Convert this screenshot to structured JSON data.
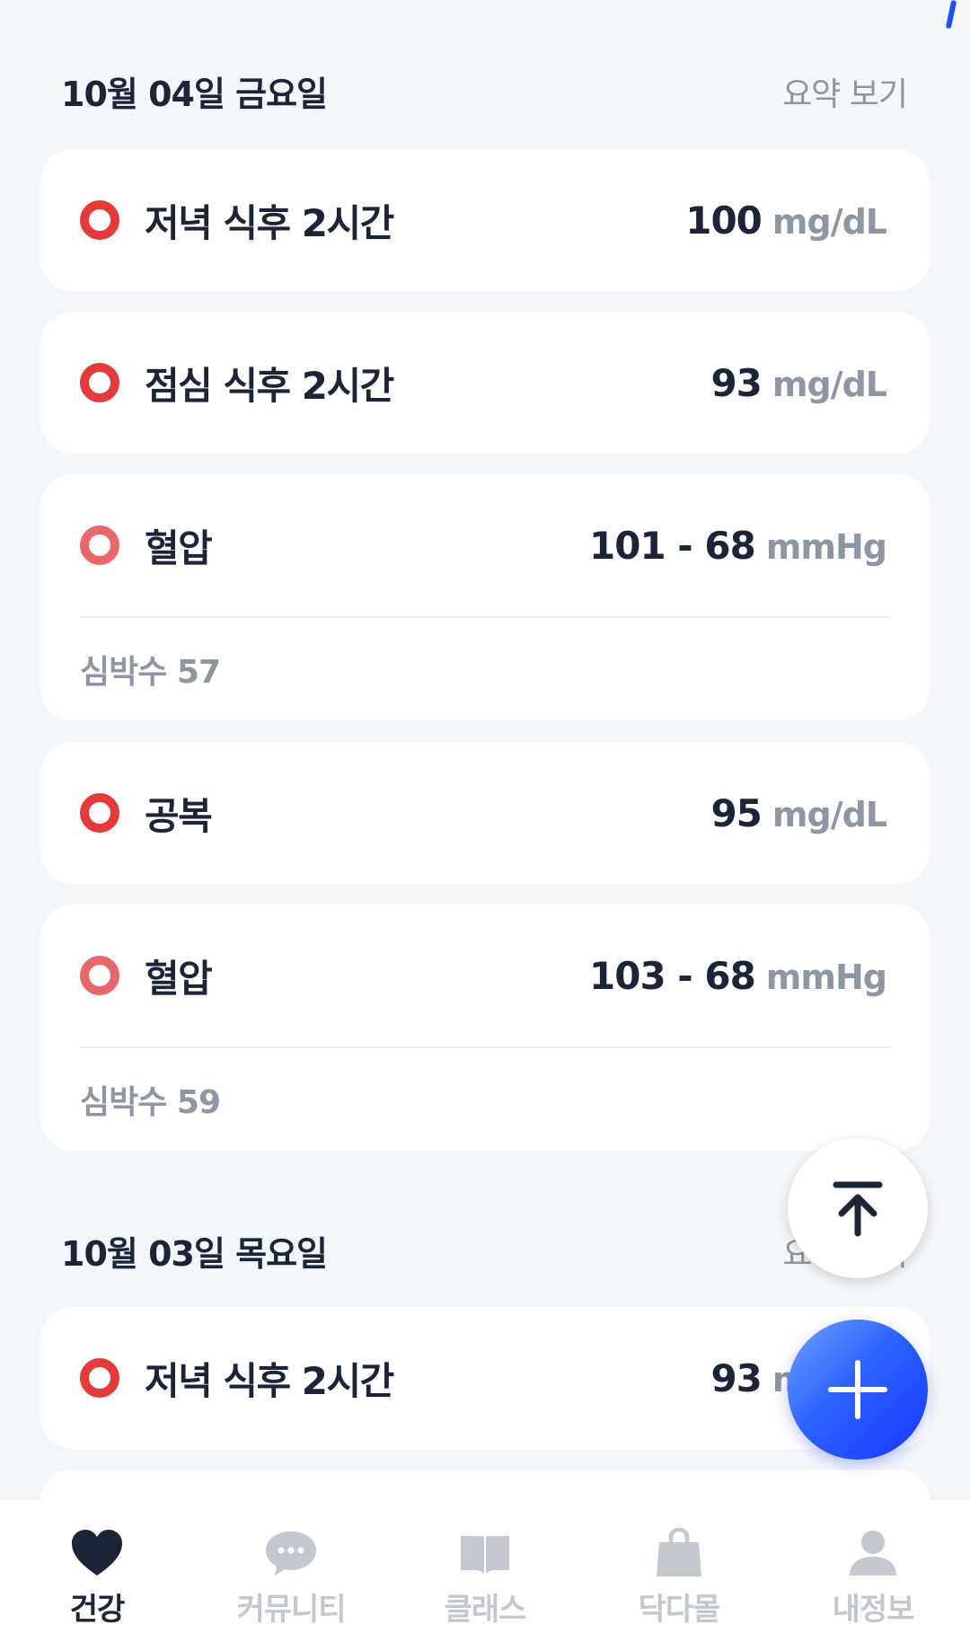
{
  "days": [
    {
      "date": "10월 04일 금요일",
      "summary_label": "요약 보기",
      "records": [
        {
          "type": "glucose",
          "label": "저녁 식후 2시간",
          "value": "100",
          "unit": "mg/dL"
        },
        {
          "type": "glucose",
          "label": "점심 식후 2시간",
          "value": "93",
          "unit": "mg/dL"
        },
        {
          "type": "bp",
          "label": "혈압",
          "value": "101 - 68",
          "unit": "mmHg",
          "sub": "심박수 57"
        },
        {
          "type": "glucose",
          "label": "공복",
          "value": "95",
          "unit": "mg/dL"
        },
        {
          "type": "bp",
          "label": "혈압",
          "value": "103 - 68",
          "unit": "mmHg",
          "sub": "심박수 59"
        }
      ]
    },
    {
      "date": "10월 03일 목요일",
      "summary_label": "요약 보기",
      "records": [
        {
          "type": "glucose",
          "label": "저녁 식후 2시간",
          "value": "93",
          "unit": "mg/dL"
        }
      ]
    }
  ],
  "fab": {
    "scroll_top_icon": "arrow-up-to-top-icon",
    "add_icon": "plus-icon"
  },
  "tabs": [
    {
      "label": "건강",
      "icon": "heart-icon",
      "active": true
    },
    {
      "label": "커뮤니티",
      "icon": "chat-bubble-icon",
      "active": false
    },
    {
      "label": "클래스",
      "icon": "book-icon",
      "active": false
    },
    {
      "label": "닥다몰",
      "icon": "shopping-bag-icon",
      "active": false
    },
    {
      "label": "내정보",
      "icon": "person-icon",
      "active": false
    }
  ],
  "colors": {
    "background": "#f3f6fa",
    "glucose_dot": "#e33a3a",
    "bp_dot": "#e9676a",
    "primary_text": "#1c2438",
    "secondary_text": "#8f96a3",
    "fab_blue": "#1f4fff",
    "tab_inactive": "#c3c8d0"
  }
}
